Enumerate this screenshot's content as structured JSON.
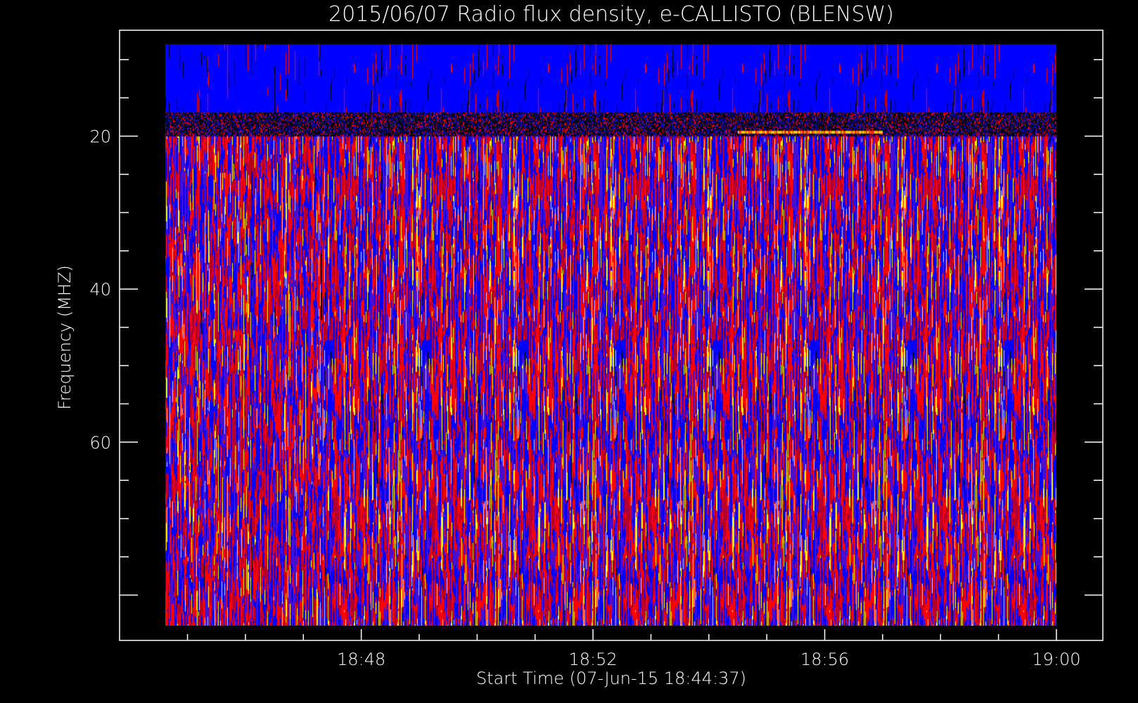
{
  "chart_data": {
    "type": "heatmap",
    "title": "2015/06/07  Radio flux density, e-CALLISTO (BLENSW)",
    "xlabel": "Start Time (07-Jun-15 18:44:37)",
    "ylabel": "Frequency (MHZ)",
    "x_range": [
      "18:44:37",
      "19:00:00"
    ],
    "y_range_mhz": [
      8,
      84
    ],
    "y_inverted": true,
    "x_tick_labels": [
      "18:48",
      "18:52",
      "18:56",
      "19:00"
    ],
    "y_tick_labels": [
      "20",
      "40",
      "60"
    ],
    "colormap": [
      "#000000",
      "#0000ff",
      "#ff0000",
      "#ffff00"
    ],
    "background_color": "#000000",
    "axis_color": "#ffffff",
    "features": {
      "bright_band_mhz": 19.5,
      "bright_band_x_range": [
        "18:54:30",
        "18:57:00"
      ]
    }
  }
}
